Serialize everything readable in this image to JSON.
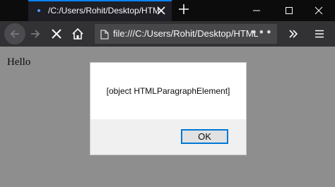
{
  "browser": {
    "tab_title": "/C:/Users/Rohit/Desktop/HTML",
    "url": "file:///C:/Users/Rohit/Desktop/HTML",
    "icons": {
      "tab_close": "close-icon",
      "new_tab": "plus-icon",
      "minimize": "minimize-icon",
      "maximize": "maximize-icon",
      "close_window": "close-icon",
      "back": "arrow-left-icon",
      "forward": "arrow-right-icon",
      "stop": "close-icon",
      "home": "home-icon",
      "page": "page-icon",
      "page_actions": "more-icon",
      "overflow": "chevron-double-right-icon",
      "menu": "hamburger-icon"
    },
    "accent_color": "#0a84ff"
  },
  "page": {
    "hello_text": "Hello",
    "background_color": "#8e8e8e"
  },
  "alert": {
    "message": "[object HTMLParagraphElement]",
    "ok_label": "OK"
  }
}
